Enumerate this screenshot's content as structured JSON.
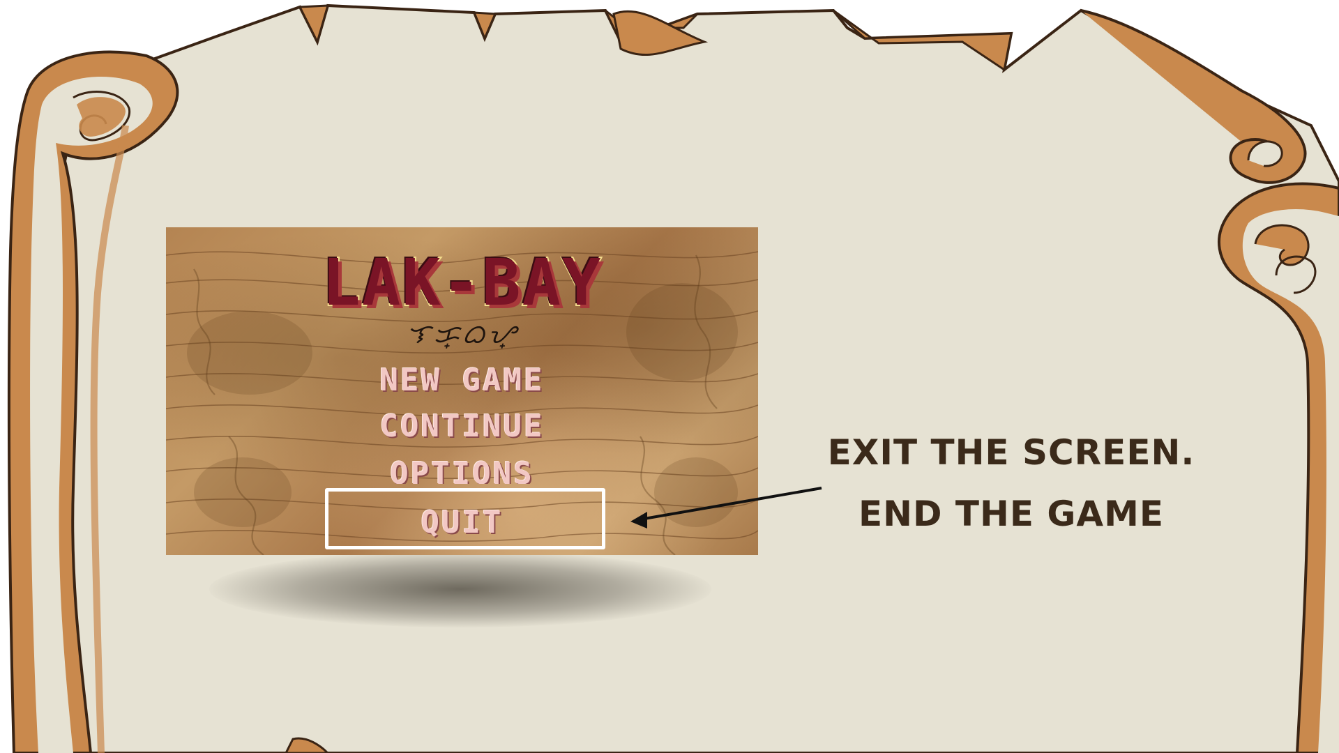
{
  "colors": {
    "parchment": "#e6e2d3",
    "scroll_edge": "#c9894d",
    "scroll_outline": "#3a2414",
    "callout_text": "#3b2a1a",
    "menu_text": "#f2c8c4",
    "title_fill": "#7a1426",
    "highlight_border": "#ffffff"
  },
  "game": {
    "title": "LAK-BAY",
    "subtitle_script": "ᜎᜃ᜔ᜊᜌ᜔",
    "menu": {
      "new_game": "NEW GAME",
      "continue": "CONTINUE",
      "options": "OPTIONS",
      "quit": "QUIT"
    },
    "selected_item": "QUIT"
  },
  "callout": {
    "line1": "EXIT THE SCREEN.",
    "line2": "END THE GAME"
  }
}
